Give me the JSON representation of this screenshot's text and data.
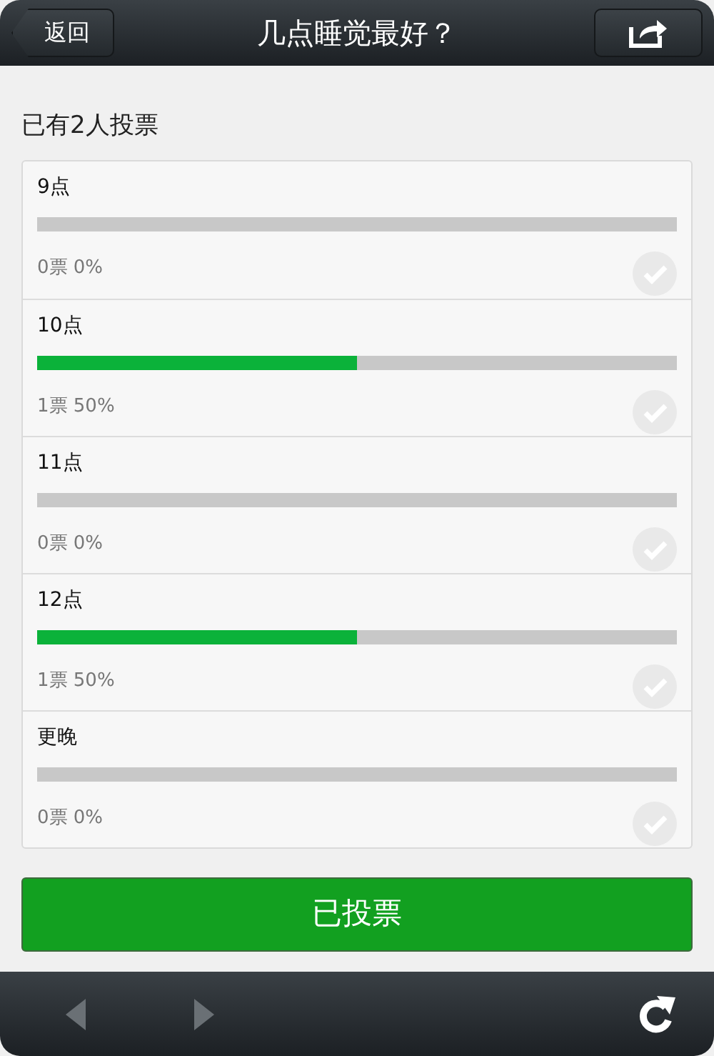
{
  "header": {
    "back": "返回",
    "title": "几点睡觉最好？"
  },
  "summary": "已有2人投票",
  "options": [
    {
      "label": "9点",
      "level": 0,
      "reading": "0票 0%"
    },
    {
      "label": "10点",
      "level": 0.5,
      "reading": "1票 50%"
    },
    {
      "label": "11点",
      "level": 0,
      "reading": "0票 0%"
    },
    {
      "label": "12点",
      "level": 0.5,
      "reading": "1票 50%"
    },
    {
      "label": "更晚",
      "level": 0,
      "reading": "0票 0%"
    }
  ],
  "vote_button": "已投票",
  "toolbar": {
    "back_disabled": true,
    "forward_disabled": true
  }
}
